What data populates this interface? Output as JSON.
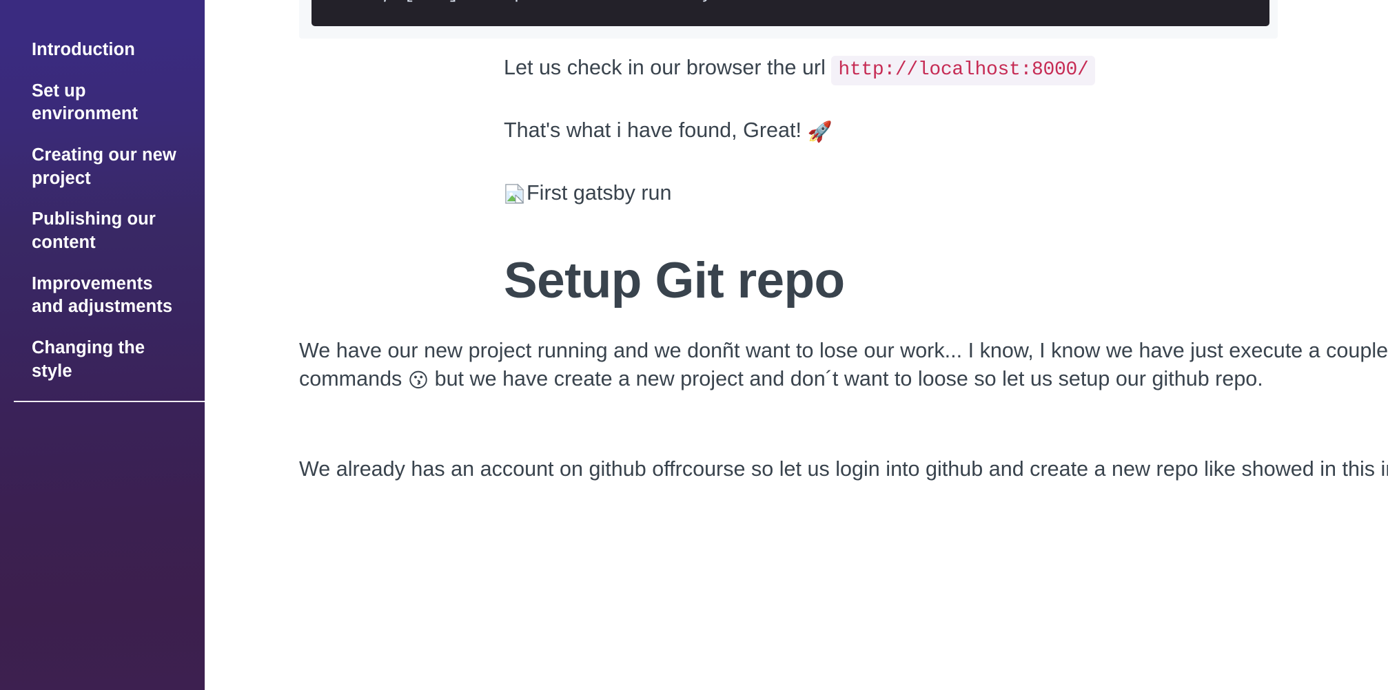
{
  "sidebar": {
    "items": [
      {
        "label": "Introduction"
      },
      {
        "label": "Set up environment"
      },
      {
        "label": "Creating our new project"
      },
      {
        "label": "Publishing our content"
      },
      {
        "label": "Improvements and adjustments"
      },
      {
        "label": "Changing the style"
      }
    ],
    "colors": {
      "gradient_top": "#3a2b80",
      "gradient_bottom": "#3d1f4d",
      "link_color": "#ffffff",
      "divider_color": "#ffffff"
    }
  },
  "main": {
    "code_block": {
      "text": "info ƒ [wdm]: Compiled successfully.",
      "background": "#232129",
      "text_color": "#d6deeb"
    },
    "url_paragraph": {
      "lead_text": "Let us check in our browser the url ",
      "inline_code": "http://localhost:8000/",
      "code_color": "#c62b54",
      "code_background": "#f4f1f8"
    },
    "found_paragraph": {
      "text": "That's what i have found, Great! ",
      "emoji": "🚀"
    },
    "broken_image": {
      "alt_text": "First gatsby run",
      "icon": "broken-image-icon"
    },
    "heading": "Setup Git repo",
    "body_paragraph_1": {
      "part_1": "We have our new project running and we donñt want to lose our work... I know, I know we have just execute a couple of commands ",
      "emoji": "😗",
      "part_2": " but we have create a new project and don´t want to loose so let us setup our github repo."
    },
    "body_paragraph_2": {
      "text": "We already has an account on github offrcourse so let us login into github and create a new repo like showed in this image"
    },
    "colors": {
      "text": "#39434d",
      "background": "#ffffff",
      "code_wrap_background": "#f6f8fa"
    }
  }
}
